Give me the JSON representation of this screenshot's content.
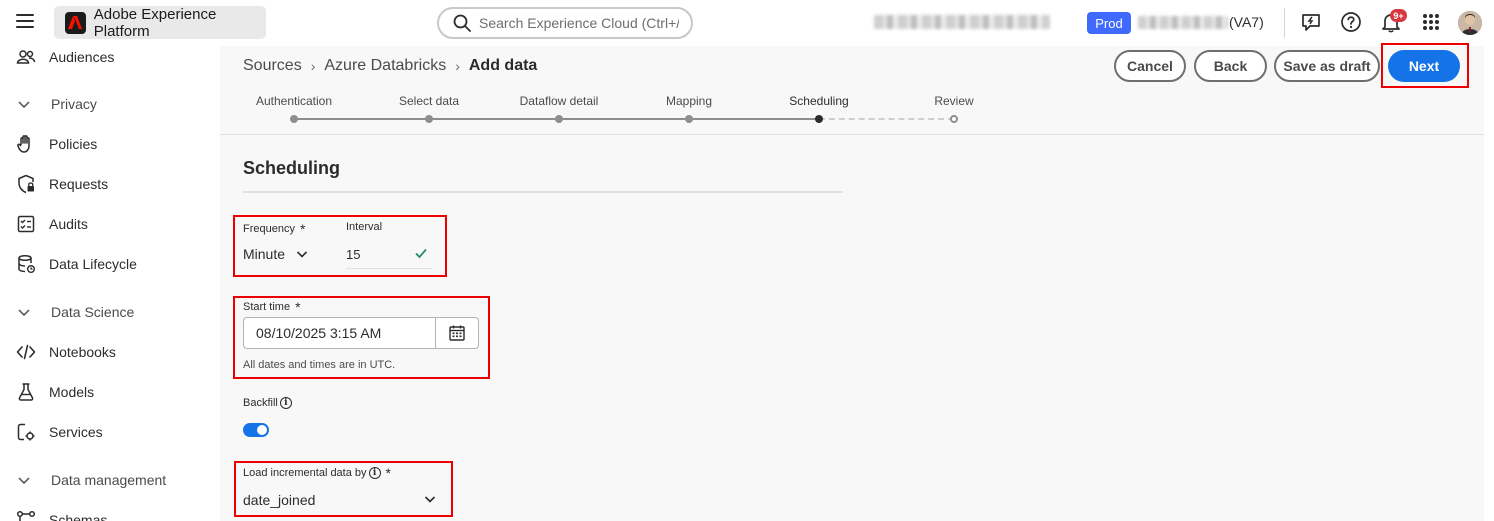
{
  "topbar": {
    "app_title": "Adobe Experience Platform",
    "search_placeholder": "Search Experience Cloud (Ctrl+/)",
    "env_badge": "Prod",
    "sandbox_suffix": "(VA7)",
    "notification_count": "9+",
    "icons": [
      "menu-icon",
      "adobe-logo-icon",
      "search-icon",
      "feedback-icon",
      "help-icon",
      "bell-icon",
      "apps-grid-icon",
      "user-avatar"
    ]
  },
  "sidebar": {
    "items": [
      {
        "type": "item",
        "label": "Audiences",
        "icon": "audiences-icon"
      },
      {
        "type": "group",
        "label": "Privacy"
      },
      {
        "type": "item",
        "label": "Policies",
        "icon": "hand-icon"
      },
      {
        "type": "item",
        "label": "Requests",
        "icon": "shield-lock-icon"
      },
      {
        "type": "item",
        "label": "Audits",
        "icon": "audit-icon"
      },
      {
        "type": "item",
        "label": "Data Lifecycle",
        "icon": "data-lifecycle-icon"
      },
      {
        "type": "group",
        "label": "Data Science"
      },
      {
        "type": "item",
        "label": "Notebooks",
        "icon": "code-icon"
      },
      {
        "type": "item",
        "label": "Models",
        "icon": "flask-icon"
      },
      {
        "type": "item",
        "label": "Services",
        "icon": "services-icon"
      },
      {
        "type": "group",
        "label": "Data management"
      },
      {
        "type": "item",
        "label": "Schemas",
        "icon": "schema-icon"
      }
    ]
  },
  "breadcrumb": {
    "items": [
      "Sources",
      "Azure Databricks"
    ],
    "current": "Add data"
  },
  "actions": {
    "cancel": "Cancel",
    "back": "Back",
    "save_draft": "Save as draft",
    "next": "Next"
  },
  "steps": [
    {
      "label": "Authentication",
      "state": "done"
    },
    {
      "label": "Select data",
      "state": "done"
    },
    {
      "label": "Dataflow detail",
      "state": "done"
    },
    {
      "label": "Mapping",
      "state": "done"
    },
    {
      "label": "Scheduling",
      "state": "active"
    },
    {
      "label": "Review",
      "state": "future"
    }
  ],
  "form": {
    "title": "Scheduling",
    "frequency": {
      "label": "Frequency",
      "required": "*",
      "value": "Minute"
    },
    "interval": {
      "label": "Interval",
      "value": "15"
    },
    "start_time": {
      "label": "Start time",
      "required": "*",
      "value": "08/10/2025 3:15 AM",
      "helper": "All dates and times are in UTC."
    },
    "backfill": {
      "label": "Backfill",
      "enabled": true
    },
    "incremental": {
      "label": "Load incremental data by",
      "required": "*",
      "value": "date_joined"
    }
  },
  "colors": {
    "accent": "#1473e6",
    "env_badge": "#4069fd",
    "highlight": "#ee0000",
    "notification": "#d7373f"
  }
}
